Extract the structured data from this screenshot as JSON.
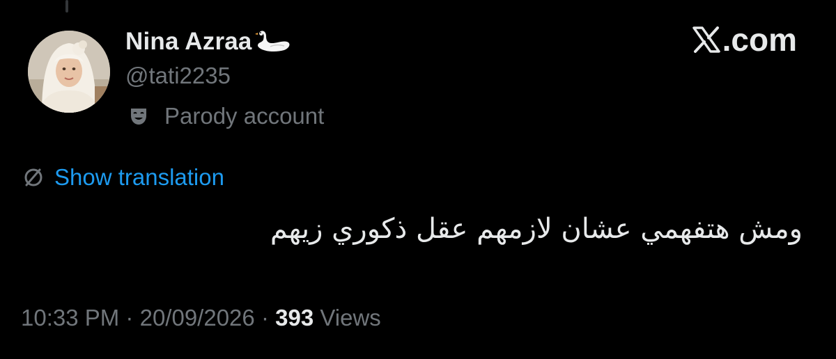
{
  "author": {
    "display_name": "Nina Azraa",
    "handle": "@tati2235",
    "name_emoji": "swan-icon",
    "label": "Parody account",
    "label_icon": "theater-mask-icon",
    "avatar": "profile-photo"
  },
  "branding": {
    "logo_icon": "x-logo-icon",
    "text": ".com"
  },
  "translation": {
    "icon": "globe-icon",
    "link_text": "Show translation"
  },
  "tweet": {
    "text": "ومش هتفهمي عشان لازمهم عقل ذكوري زيهم"
  },
  "meta": {
    "time": "10:33 PM",
    "separator": "·",
    "date": "20/09/2026",
    "views_count": "393",
    "views_label": "Views"
  },
  "colors": {
    "background": "#000000",
    "primary_text": "#e7e9ea",
    "secondary_text": "#71767b",
    "link": "#1d9bf0"
  }
}
